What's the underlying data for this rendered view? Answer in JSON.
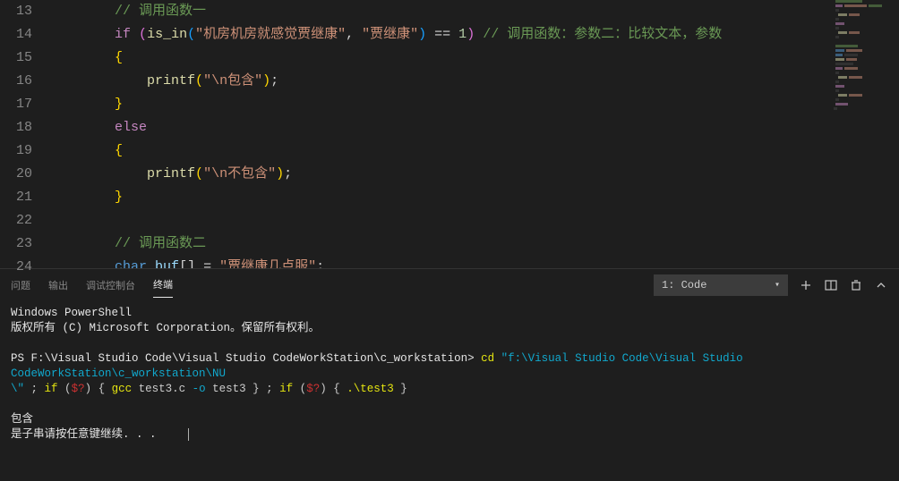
{
  "editor": {
    "lines": [
      {
        "num": "13",
        "indent": 2,
        "tokens": [
          {
            "cls": "tok-comment",
            "t": "// 调用函数一"
          }
        ]
      },
      {
        "num": "14",
        "indent": 2,
        "tokens": [
          {
            "cls": "tok-keyword",
            "t": "if"
          },
          {
            "cls": "tok-default",
            "t": " "
          },
          {
            "cls": "tok-paren",
            "t": "("
          },
          {
            "cls": "tok-func",
            "t": "is_in"
          },
          {
            "cls": "tok-paren2",
            "t": "("
          },
          {
            "cls": "tok-string",
            "t": "\"机房机房就感觉贾继康\""
          },
          {
            "cls": "tok-default",
            "t": ", "
          },
          {
            "cls": "tok-string",
            "t": "\"贾继康\""
          },
          {
            "cls": "tok-paren2",
            "t": ")"
          },
          {
            "cls": "tok-default",
            "t": " == "
          },
          {
            "cls": "tok-number",
            "t": "1"
          },
          {
            "cls": "tok-paren",
            "t": ")"
          },
          {
            "cls": "tok-default",
            "t": " "
          },
          {
            "cls": "tok-comment",
            "t": "// 调用函数：参数二：比较文本，参数"
          }
        ]
      },
      {
        "num": "15",
        "indent": 2,
        "tokens": [
          {
            "cls": "tok-brace",
            "t": "{"
          }
        ]
      },
      {
        "num": "16",
        "indent": 3,
        "tokens": [
          {
            "cls": "tok-func",
            "t": "printf"
          },
          {
            "cls": "tok-brace",
            "t": "("
          },
          {
            "cls": "tok-string",
            "t": "\"\\n包含\""
          },
          {
            "cls": "tok-brace",
            "t": ")"
          },
          {
            "cls": "tok-default",
            "t": ";"
          }
        ]
      },
      {
        "num": "17",
        "indent": 2,
        "tokens": [
          {
            "cls": "tok-brace",
            "t": "}"
          }
        ]
      },
      {
        "num": "18",
        "indent": 2,
        "tokens": [
          {
            "cls": "tok-keyword",
            "t": "else"
          }
        ]
      },
      {
        "num": "19",
        "indent": 2,
        "tokens": [
          {
            "cls": "tok-brace",
            "t": "{"
          }
        ]
      },
      {
        "num": "20",
        "indent": 3,
        "tokens": [
          {
            "cls": "tok-func",
            "t": "printf"
          },
          {
            "cls": "tok-brace",
            "t": "("
          },
          {
            "cls": "tok-string",
            "t": "\"\\n不包含\""
          },
          {
            "cls": "tok-brace",
            "t": ")"
          },
          {
            "cls": "tok-default",
            "t": ";"
          }
        ]
      },
      {
        "num": "21",
        "indent": 2,
        "tokens": [
          {
            "cls": "tok-brace",
            "t": "}"
          }
        ]
      },
      {
        "num": "22",
        "indent": 0,
        "tokens": []
      },
      {
        "num": "23",
        "indent": 2,
        "tokens": [
          {
            "cls": "tok-comment",
            "t": "// 调用函数二"
          }
        ]
      },
      {
        "num": "24",
        "indent": 2,
        "tokens": [
          {
            "cls": "tok-type",
            "t": "char"
          },
          {
            "cls": "tok-default",
            "t": " "
          },
          {
            "cls": "tok-var",
            "t": "buf"
          },
          {
            "cls": "tok-default",
            "t": "[] = "
          },
          {
            "cls": "tok-string",
            "t": "\"贾继康几点服\""
          },
          {
            "cls": "tok-default",
            "t": ";"
          }
        ]
      }
    ]
  },
  "panel": {
    "tabs": {
      "problems": "问题",
      "output": "输出",
      "debug_console": "调试控制台",
      "terminal": "终端"
    },
    "terminal_selector": "1: Code",
    "terminal": {
      "line1": "Windows PowerShell",
      "line2": "版权所有 (C) Microsoft Corporation。保留所有权利。",
      "prompt": "PS F:\\Visual Studio Code\\Visual Studio CodeWorkStation\\c_workstation> ",
      "cmd_cd": "cd",
      "cmd_path": " \"f:\\Visual Studio Code\\Visual Studio CodeWorkStation\\c_workstation\\NU",
      "line_cont_start": "\\\"",
      "cmd_sep1": " ; ",
      "cmd_if1": "if",
      "cmd_paren1a": " (",
      "cmd_cond1": "$?",
      "cmd_paren1b": ") { ",
      "cmd_gcc": "gcc",
      "cmd_gcc_args1": " test3.c ",
      "cmd_gcc_o": "-o",
      "cmd_gcc_args2": " test3 } ; ",
      "cmd_if2": "if",
      "cmd_paren2a": " (",
      "cmd_cond2": "$?",
      "cmd_paren2b": ") { ",
      "cmd_run": ".\\test3",
      "cmd_end": " }",
      "out1": "包含",
      "out2": "是子串请按任意键继续. . ."
    }
  }
}
